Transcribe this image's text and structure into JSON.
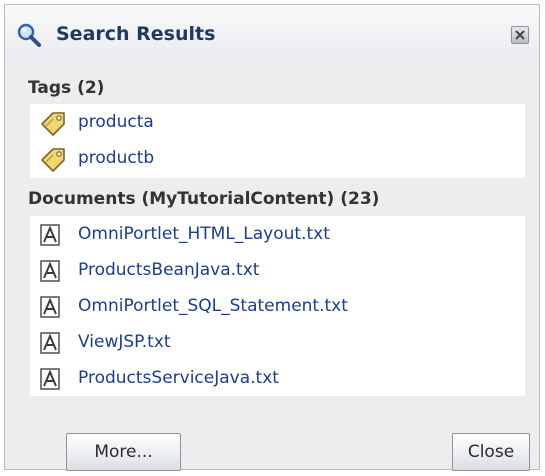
{
  "dialog": {
    "title": "Search Results",
    "accent": "#1f3a60",
    "link_color": "#1a3d8f"
  },
  "tags": {
    "heading": "Tags (2)",
    "items": [
      {
        "label": "producta",
        "icon": "tag-icon"
      },
      {
        "label": "productb",
        "icon": "tag-icon"
      }
    ]
  },
  "documents": {
    "heading": "Documents (MyTutorialContent) (23)",
    "items": [
      {
        "label": "OmniPortlet_HTML_Layout.txt",
        "icon": "document-icon"
      },
      {
        "label": "ProductsBeanJava.txt",
        "icon": "document-icon"
      },
      {
        "label": "OmniPortlet_SQL_Statement.txt",
        "icon": "document-icon"
      },
      {
        "label": "ViewJSP.txt",
        "icon": "document-icon"
      },
      {
        "label": "ProductsServiceJava.txt",
        "icon": "document-icon"
      }
    ]
  },
  "buttons": {
    "more": "More...",
    "close": "Close"
  }
}
